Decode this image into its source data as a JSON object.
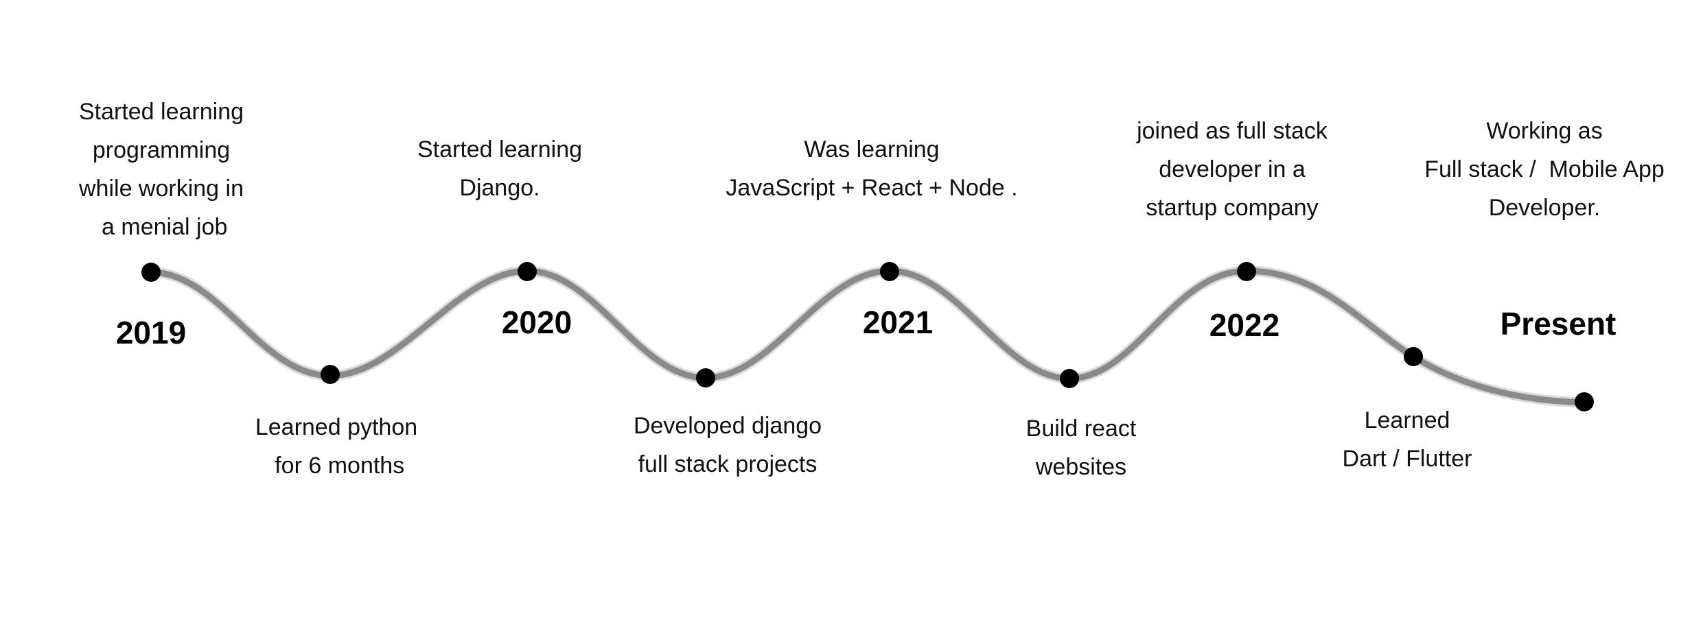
{
  "title": "",
  "milestones_above": [
    "Started learning\nprogramming\nwhile working in\n a menial job",
    "Started learning\nDjango.",
    "Was learning\nJavaScript + React + Node .",
    "joined as full stack\ndeveloper in a\nstartup company",
    "Working as\nFull stack /  Mobile App\nDeveloper."
  ],
  "milestones_below": [
    "Learned python\n for 6 months",
    "Developed django\nfull stack projects",
    "Build react\nwebsites",
    "Learned\nDart / Flutter"
  ],
  "years": [
    "2019",
    "2020",
    "2021",
    "2022",
    "Present"
  ],
  "colors": {
    "line": "#8a8a8a",
    "dot": "#000000",
    "text": "#111111"
  }
}
